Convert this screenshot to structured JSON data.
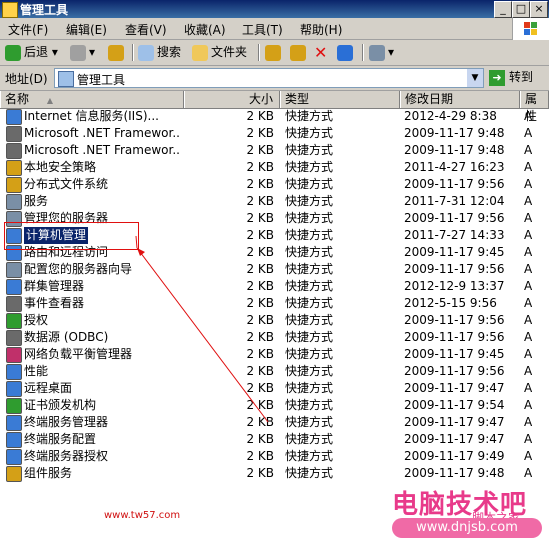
{
  "window": {
    "title": "管理工具"
  },
  "menu": [
    "文件(F)",
    "编辑(E)",
    "查看(V)",
    "收藏(A)",
    "工具(T)",
    "帮助(H)"
  ],
  "toolbar": {
    "back": "后退",
    "search": "搜索",
    "folders": "文件夹"
  },
  "address": {
    "label": "地址(D)",
    "value": "管理工具",
    "go": "转到"
  },
  "columns": {
    "name": "名称",
    "size": "大小",
    "type": "类型",
    "modified": "修改日期",
    "attr": "属性"
  },
  "files": [
    {
      "name": "Internet 信息服务(IIS)...",
      "size": "2 KB",
      "type": "快捷方式",
      "date": "2012-4-29 8:38",
      "attr": "A",
      "color": "#3a7bd5"
    },
    {
      "name": "Microsoft .NET Framewor...",
      "size": "2 KB",
      "type": "快捷方式",
      "date": "2009-11-17 9:48",
      "attr": "A",
      "color": "#6a6a6a"
    },
    {
      "name": "Microsoft .NET Framewor...",
      "size": "2 KB",
      "type": "快捷方式",
      "date": "2009-11-17 9:48",
      "attr": "A",
      "color": "#6a6a6a"
    },
    {
      "name": "本地安全策略",
      "size": "2 KB",
      "type": "快捷方式",
      "date": "2011-4-27 16:23",
      "attr": "A",
      "color": "#d4a017"
    },
    {
      "name": "分布式文件系统",
      "size": "2 KB",
      "type": "快捷方式",
      "date": "2009-11-17 9:56",
      "attr": "A",
      "color": "#d4a017"
    },
    {
      "name": "服务",
      "size": "2 KB",
      "type": "快捷方式",
      "date": "2011-7-31 12:04",
      "attr": "A",
      "color": "#7a8fa6"
    },
    {
      "name": "管理您的服务器",
      "size": "2 KB",
      "type": "快捷方式",
      "date": "2009-11-17 9:56",
      "attr": "A",
      "color": "#7a8fa6"
    },
    {
      "name": "计算机管理",
      "size": "2 KB",
      "type": "快捷方式",
      "date": "2011-7-27 14:33",
      "attr": "A",
      "color": "#3a7bd5",
      "selected": true
    },
    {
      "name": "路由和远程访问",
      "size": "2 KB",
      "type": "快捷方式",
      "date": "2009-11-17 9:45",
      "attr": "A",
      "color": "#3a7bd5"
    },
    {
      "name": "配置您的服务器向导",
      "size": "2 KB",
      "type": "快捷方式",
      "date": "2009-11-17 9:56",
      "attr": "A",
      "color": "#7a8fa6"
    },
    {
      "name": "群集管理器",
      "size": "2 KB",
      "type": "快捷方式",
      "date": "2012-12-9 13:37",
      "attr": "A",
      "color": "#3a7bd5"
    },
    {
      "name": "事件查看器",
      "size": "2 KB",
      "type": "快捷方式",
      "date": "2012-5-15 9:56",
      "attr": "A",
      "color": "#6a6a6a"
    },
    {
      "name": "授权",
      "size": "2 KB",
      "type": "快捷方式",
      "date": "2009-11-17 9:56",
      "attr": "A",
      "color": "#2f9c2f"
    },
    {
      "name": "数据源 (ODBC)",
      "size": "2 KB",
      "type": "快捷方式",
      "date": "2009-11-17 9:56",
      "attr": "A",
      "color": "#6a6a6a"
    },
    {
      "name": "网络负载平衡管理器",
      "size": "2 KB",
      "type": "快捷方式",
      "date": "2009-11-17 9:45",
      "attr": "A",
      "color": "#c0306a"
    },
    {
      "name": "性能",
      "size": "2 KB",
      "type": "快捷方式",
      "date": "2009-11-17 9:56",
      "attr": "A",
      "color": "#3a7bd5"
    },
    {
      "name": "远程桌面",
      "size": "2 KB",
      "type": "快捷方式",
      "date": "2009-11-17 9:47",
      "attr": "A",
      "color": "#3a7bd5"
    },
    {
      "name": "证书颁发机构",
      "size": "2 KB",
      "type": "快捷方式",
      "date": "2009-11-17 9:54",
      "attr": "A",
      "color": "#2f9c2f"
    },
    {
      "name": "终端服务管理器",
      "size": "2 KB",
      "type": "快捷方式",
      "date": "2009-11-17 9:47",
      "attr": "A",
      "color": "#3a7bd5"
    },
    {
      "name": "终端服务配置",
      "size": "2 KB",
      "type": "快捷方式",
      "date": "2009-11-17 9:47",
      "attr": "A",
      "color": "#3a7bd5"
    },
    {
      "name": "终端服务器授权",
      "size": "2 KB",
      "type": "快捷方式",
      "date": "2009-11-17 9:49",
      "attr": "A",
      "color": "#3a7bd5"
    },
    {
      "name": "组件服务",
      "size": "2 KB",
      "type": "快捷方式",
      "date": "2009-11-17 9:48",
      "attr": "A",
      "color": "#d4a017"
    }
  ],
  "watermark": {
    "site": "www.tw57.com",
    "brand": "电脑技术吧",
    "sub": "脚本之家",
    "url": "www.dnjsb.com"
  }
}
